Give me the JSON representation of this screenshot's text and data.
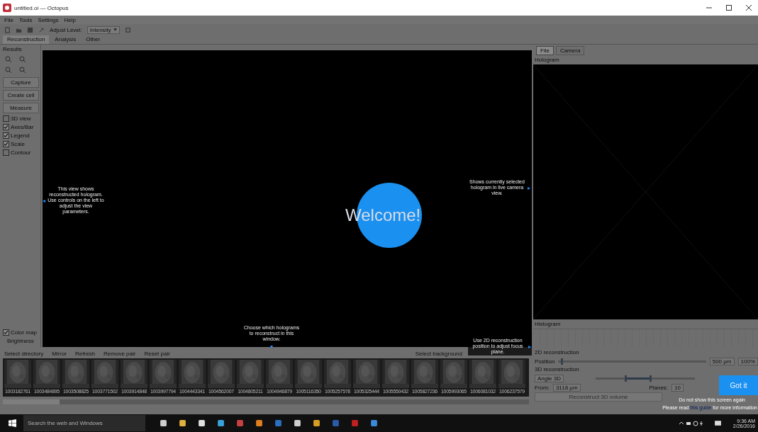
{
  "window": {
    "title": "untitled.oi — Octopus"
  },
  "menu": [
    "File",
    "Tools",
    "Settings",
    "Help"
  ],
  "toolbar": {
    "adjust_label": "Adjust Level:",
    "adjust_value": "Intensity"
  },
  "tabs": [
    {
      "label": "Reconstruction",
      "selected": true
    },
    {
      "label": "Analysis",
      "selected": false
    },
    {
      "label": "Other",
      "selected": false
    }
  ],
  "left_panel": {
    "title": "Results",
    "capture_button": "Capture",
    "buttons": [
      "Create cell",
      "Measure"
    ],
    "options": [
      {
        "label": "3D view",
        "checked": false
      },
      {
        "label": "Axes/Bar",
        "checked": true
      },
      {
        "label": "Legend",
        "checked": true
      },
      {
        "label": "Scale",
        "checked": true
      },
      {
        "label": "Contour",
        "checked": false
      }
    ],
    "color_map": {
      "label": "Color map",
      "checked": true
    },
    "brightness_label": "Brightness"
  },
  "viewer": {
    "welcome": "Welcome!",
    "tips": [
      {
        "text": "This view shows reconstructed hologram. Use controls on the left to adjust the view parameters.",
        "pointer": "◂",
        "kind": "left"
      },
      {
        "text": "Shows currently selected hologram in live camera view.",
        "pointer": "▸",
        "kind": "right"
      },
      {
        "text": "Choose which holograms to reconstruct in this window.",
        "pointer": "▾",
        "kind": "down"
      },
      {
        "text": "Use 2D reconstruction position to adjust focus plane.",
        "pointer": "▸",
        "kind": "right"
      }
    ]
  },
  "right_panel": {
    "tabs": [
      {
        "label": "File",
        "selected": true
      },
      {
        "label": "Camera",
        "selected": false
      }
    ],
    "hologram_label": "Hologram",
    "histogram_label": "Histogram"
  },
  "strip": {
    "actions": [
      "Select directory",
      "Mirror",
      "Refresh",
      "Remove pair",
      "Reset pair"
    ],
    "background_button": "Select background",
    "thumbnails": [
      "1003182761",
      "1003484895",
      "1003508825",
      "1003771502",
      "1003914848",
      "1003997794",
      "1004443341",
      "1004562007",
      "1004805211",
      "1004946879",
      "1005116350",
      "1005257578",
      "1005325444",
      "1005550432",
      "1005827236",
      "1005993065",
      "1006081032",
      "1006237579"
    ]
  },
  "reconstruction": {
    "title_2d": "2D reconstruction",
    "position_label": "Position",
    "position_slider": {
      "level": 0.02
    },
    "position_value": "500 µm",
    "zoom_value": "100%",
    "title_3d": "3D reconstruction",
    "angle_label": "Angle 3D",
    "range_handles": [
      {
        "level": 0.3
      },
      {
        "level": 0.55
      }
    ],
    "from_label": "From:",
    "from_value": "3118 µm",
    "planes_label": "Planes:",
    "planes_value": "10",
    "reconstruct_button": "Reconstruct 3D volume"
  },
  "welcome_dialog": {
    "got_it": "Got it",
    "dont_show": "Do not show this screen again",
    "read_prefix": "Please read",
    "read_link": "this guide",
    "read_suffix": "for more information"
  },
  "taskbar": {
    "search_placeholder": "Search the web and Windows",
    "time": "9:36 AM",
    "date": "2/26/2016"
  }
}
